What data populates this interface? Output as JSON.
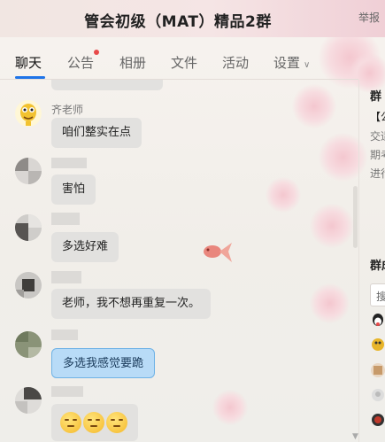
{
  "window": {
    "title": "管会初级（MAT）精品2群",
    "report_label": "举报"
  },
  "tabs": [
    {
      "label": "聊天",
      "active": true
    },
    {
      "label": "公告",
      "active": false,
      "badge": "red-dot"
    },
    {
      "label": "相册",
      "active": false
    },
    {
      "label": "文件",
      "active": false
    },
    {
      "label": "活动",
      "active": false
    },
    {
      "label": "设置",
      "active": false,
      "icon": "chevron-down-icon"
    }
  ],
  "side_panel": {
    "announcement_heading": "群",
    "announcement_line1": "【公",
    "announcement_line2": "交适",
    "announcement_line3": "期考",
    "announcement_line4": "进行",
    "members_heading": "群成",
    "search_placeholder": "搜"
  },
  "chat": {
    "messages": [
      {
        "sender": "齐老师",
        "text": "咱们整实在点",
        "style": "gray"
      },
      {
        "sender": "",
        "text": "害怕",
        "style": "gray"
      },
      {
        "sender": "",
        "text": "多选好难",
        "style": "gray"
      },
      {
        "sender": "",
        "text": "老师，我不想再重复一次。",
        "style": "gray"
      },
      {
        "sender": "",
        "text": "多选我感觉要跪",
        "style": "blue"
      },
      {
        "sender": "",
        "text": "",
        "style": "gray",
        "emojis": [
          "smirk-emoji",
          "smirk-emoji",
          "smirk-emoji"
        ]
      }
    ]
  },
  "colors": {
    "accent": "#1e74e8",
    "bubble_gray": "#e2e1df",
    "bubble_blue": "#b8dbf7",
    "badge_red": "#e84a4a"
  }
}
